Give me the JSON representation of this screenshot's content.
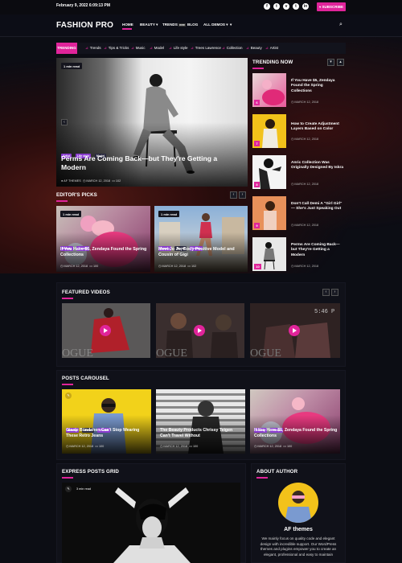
{
  "topbar": {
    "date": "February 9, 2022 6:09:13 PM",
    "subscribe_label": "SUBSCRIBE",
    "social_icons": [
      "facebook-icon",
      "twitter-icon",
      "vimeo-icon",
      "twitter-icon",
      "linkedin-icon",
      "vk-icon",
      "youtube-icon"
    ]
  },
  "header": {
    "logo": "FASHION PRO",
    "nav": [
      "HOME",
      "BEAUTY",
      "TRENDS",
      "BLOG",
      "ALL DEMOS"
    ],
    "nav_badge": "new",
    "accent": "#e0249a"
  },
  "trending_bar": {
    "label": "TRENDING",
    "tags": [
      "Trends",
      "Tips & Tricks",
      "Music",
      "Model",
      "Life style",
      "Trees Lawrence",
      "Collection",
      "Beauty",
      "Artist"
    ]
  },
  "hero": {
    "read_time": "1 min read",
    "pills": [
      "Artist",
      "Life style",
      "Model"
    ],
    "title": "Perms Are Coming Back—but They're Getting a Modern",
    "author": "AF THEMES",
    "date": "MARCH 12, 2018",
    "comments": "102"
  },
  "editors_picks": {
    "title": "EDITOR'S PICKS",
    "items": [
      {
        "read_time": "1 min read",
        "pills": [
          "Beauty",
          "Trends"
        ],
        "title": "If You Have $5, Zendaya Found the Spring Collections",
        "date": "MARCH 12, 2018",
        "comments": "100"
      },
      {
        "read_time": "1 min read",
        "pills": [
          "Beauty",
          "Model",
          "Trends"
        ],
        "title": "Meet Jo Jo, Body Positive Model and Cousin of Gigi",
        "date": "MARCH 12, 2018",
        "comments": "102"
      }
    ]
  },
  "trending_now": {
    "title": "TRENDING NOW",
    "items": [
      {
        "num": "6",
        "title": "If You Have $5, Zendaya Found the Spring Collections",
        "date": "MARCH 12, 2018"
      },
      {
        "num": "7",
        "title": "How to Create Adjustment Layers Based on Color",
        "date": "MARCH 12, 2018"
      },
      {
        "num": "8",
        "title": "Anric Collection Was Originally Designed By Iskra",
        "date": "MARCH 12, 2018"
      },
      {
        "num": "9",
        "title": "Don't Call Demi A \"Girl Girl\" — She's Just Speaking Out",
        "date": "MARCH 12, 2018"
      },
      {
        "num": "10",
        "title": "Perms Are Coming Back—but They're Getting a Modern",
        "date": "MARCH 12, 2018"
      }
    ]
  },
  "featured_videos": {
    "title": "FEATURED VIDEOS",
    "watermark": "OGUE",
    "clock": "5:46 P"
  },
  "posts_carousel": {
    "title": "POSTS CAROUSEL",
    "items": [
      {
        "pills": [
          "Beauty",
          "Model",
          "Trends"
        ],
        "title": "Gisele Bündchen Can't Stop Wearing These Retro Jeans",
        "date": "MARCH 12, 2018",
        "comments": "100"
      },
      {
        "pills": [],
        "title": "The Beauty Products Chrissy Teigen Can't Travel Without",
        "date": "MARCH 12, 2018",
        "comments": "100"
      },
      {
        "pills": [
          "Beauty",
          "Trends"
        ],
        "title": "If You Have $5, Zendaya Found the Spring Collections",
        "date": "MARCH 12, 2018",
        "comments": "100"
      }
    ]
  },
  "express_grid": {
    "title": "EXPRESS POSTS GRID",
    "read_time": "3 min read"
  },
  "about_author": {
    "title": "ABOUT AUTHOR",
    "name": "AF themes",
    "bio": "We mainly focus on quality code and elegant design with incredible support. Our WordPress themes and plugins empower you to create an elegant, professional and easy to maintain"
  }
}
